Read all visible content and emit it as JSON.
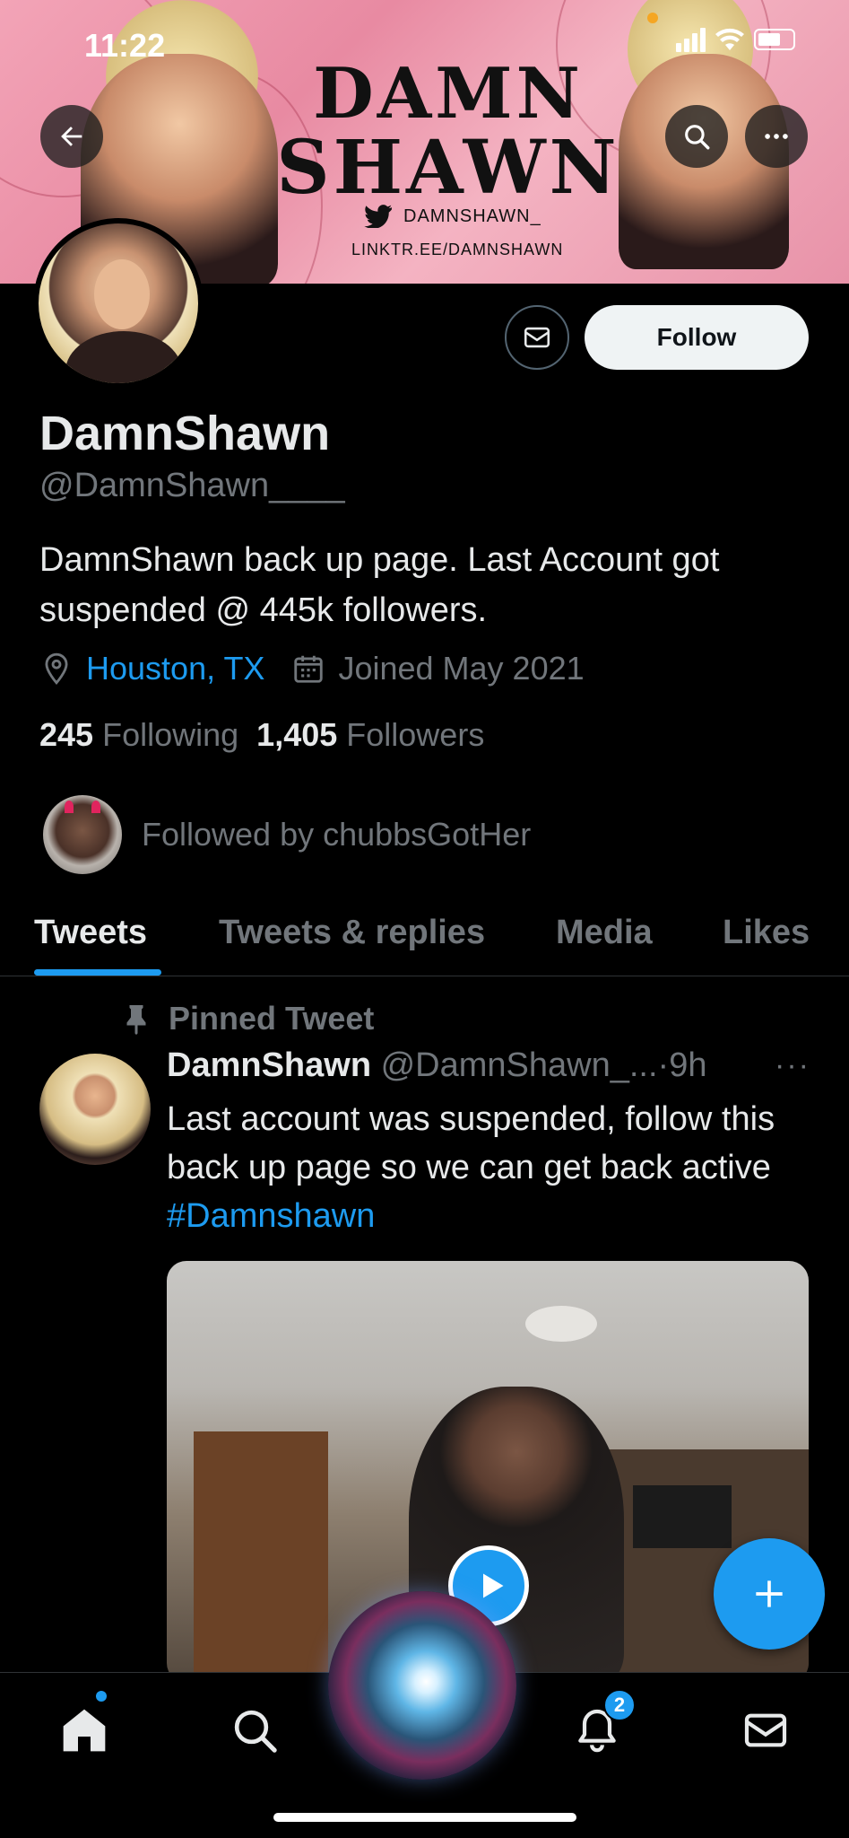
{
  "status_bar": {
    "time": "11:22"
  },
  "banner": {
    "title_line1": "DAMN",
    "title_line2": "SHAWN",
    "twitter_handle": "DAMNSHAWN_",
    "link": "LINKTR.EE/DAMNSHAWN"
  },
  "header_buttons": {
    "back_icon": "arrow-left-icon",
    "search_icon": "search-icon",
    "more_icon": "more-icon"
  },
  "profile": {
    "display_name": "DamnShawn",
    "handle": "@DamnShawn____",
    "bio": "DamnShawn back up page. Last Account got suspended @ 445k followers.",
    "location": "Houston, TX",
    "joined": "Joined May 2021",
    "following_count": "245",
    "following_label": "Following",
    "followers_count": "1,405",
    "followers_label": "Followers",
    "followed_by": "Followed by chubbsGotHer",
    "follow_button": "Follow"
  },
  "tabs": [
    {
      "label": "Tweets",
      "active": true
    },
    {
      "label": "Tweets & replies",
      "active": false
    },
    {
      "label": "Media",
      "active": false
    },
    {
      "label": "Likes",
      "active": false
    }
  ],
  "tweet": {
    "pinned_label": "Pinned Tweet",
    "author_name": "DamnShawn",
    "author_handle": "@DamnShawn_...",
    "separator": "·",
    "time": "9h",
    "more": "···",
    "text": "Last account was suspended, follow this back up page so we can get back active ",
    "hashtag": "#Damnshawn"
  },
  "bottom_nav": {
    "items": [
      "home-icon",
      "search-icon",
      "siri-orb",
      "bell-icon",
      "mail-icon"
    ],
    "notifications_badge": "2"
  },
  "colors": {
    "accent": "#1d9bf0",
    "background": "#000000",
    "muted": "#71767b",
    "text": "#e7e9ea"
  }
}
